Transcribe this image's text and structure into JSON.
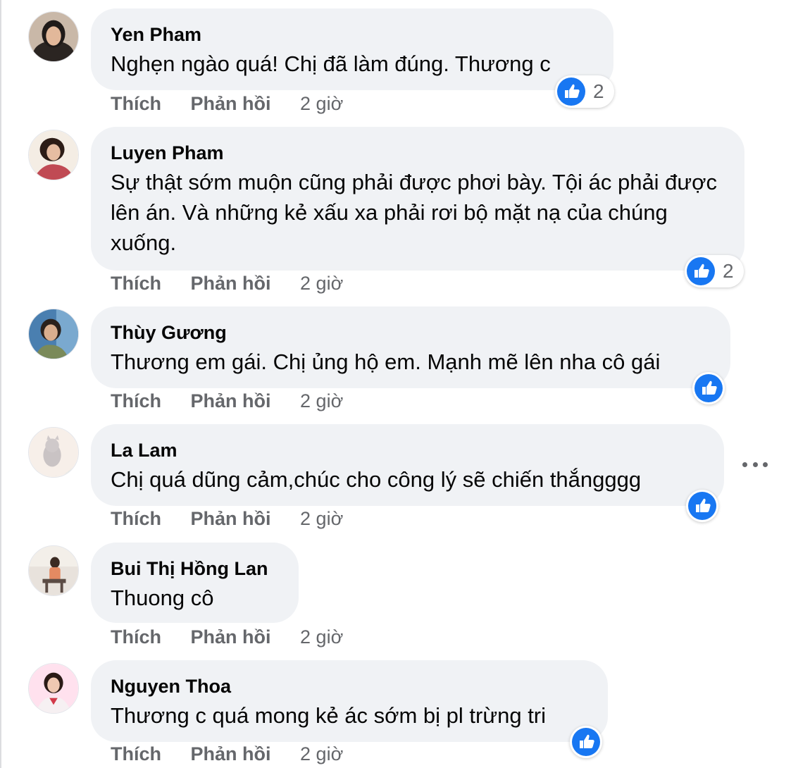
{
  "comments": [
    {
      "name": "Yen Pham",
      "text": "Nghẹn ngào quá! Chị đã làm đúng. Thương c",
      "like": "Thích",
      "reply": "Phản hồi",
      "time": "2 giờ",
      "reaction_count": "2",
      "avatar_icon": "profile-photo"
    },
    {
      "name": "Luyen Pham",
      "text": "Sự thật sớm muộn cũng phải được phơi bày. Tội ác phải được lên án. Và những kẻ xấu xa phải rơi bộ mặt nạ của chúng xuống.",
      "like": "Thích",
      "reply": "Phản hồi",
      "time": "2 giờ",
      "reaction_count": "2",
      "avatar_icon": "profile-photo"
    },
    {
      "name": "Thùy Gương",
      "text": "Thương em gái. Chị ủng hộ em. Mạnh mẽ lên nha cô gái",
      "like": "Thích",
      "reply": "Phản hồi",
      "time": "2 giờ",
      "reaction_count": "",
      "avatar_icon": "profile-photo"
    },
    {
      "name": "La Lam",
      "text": "Chị quá dũng cảm,chúc cho công lý sẽ chiến thắngggg",
      "like": "Thích",
      "reply": "Phản hồi",
      "time": "2 giờ",
      "reaction_count": "",
      "avatar_icon": "cat-moon-illustration"
    },
    {
      "name": "Bui Thị Hồng Lan",
      "text": "Thuong cô",
      "like": "Thích",
      "reply": "Phản hồi",
      "time": "2 giờ",
      "reaction_count": "",
      "avatar_icon": "profile-photo"
    },
    {
      "name": "Nguyen Thoa",
      "text": "Thương c quá mong kẻ ác sớm bị pl trừng tri",
      "like": "Thích",
      "reply": "Phản hồi",
      "time": "2 giờ",
      "reaction_count": "",
      "avatar_icon": "profile-photo"
    }
  ],
  "colors": {
    "bubble": "#f0f2f5",
    "like_blue": "#1877f2",
    "meta_gray": "#65676b",
    "text": "#050505"
  },
  "icons": [
    "like-thumb-icon",
    "more-options-icon"
  ]
}
